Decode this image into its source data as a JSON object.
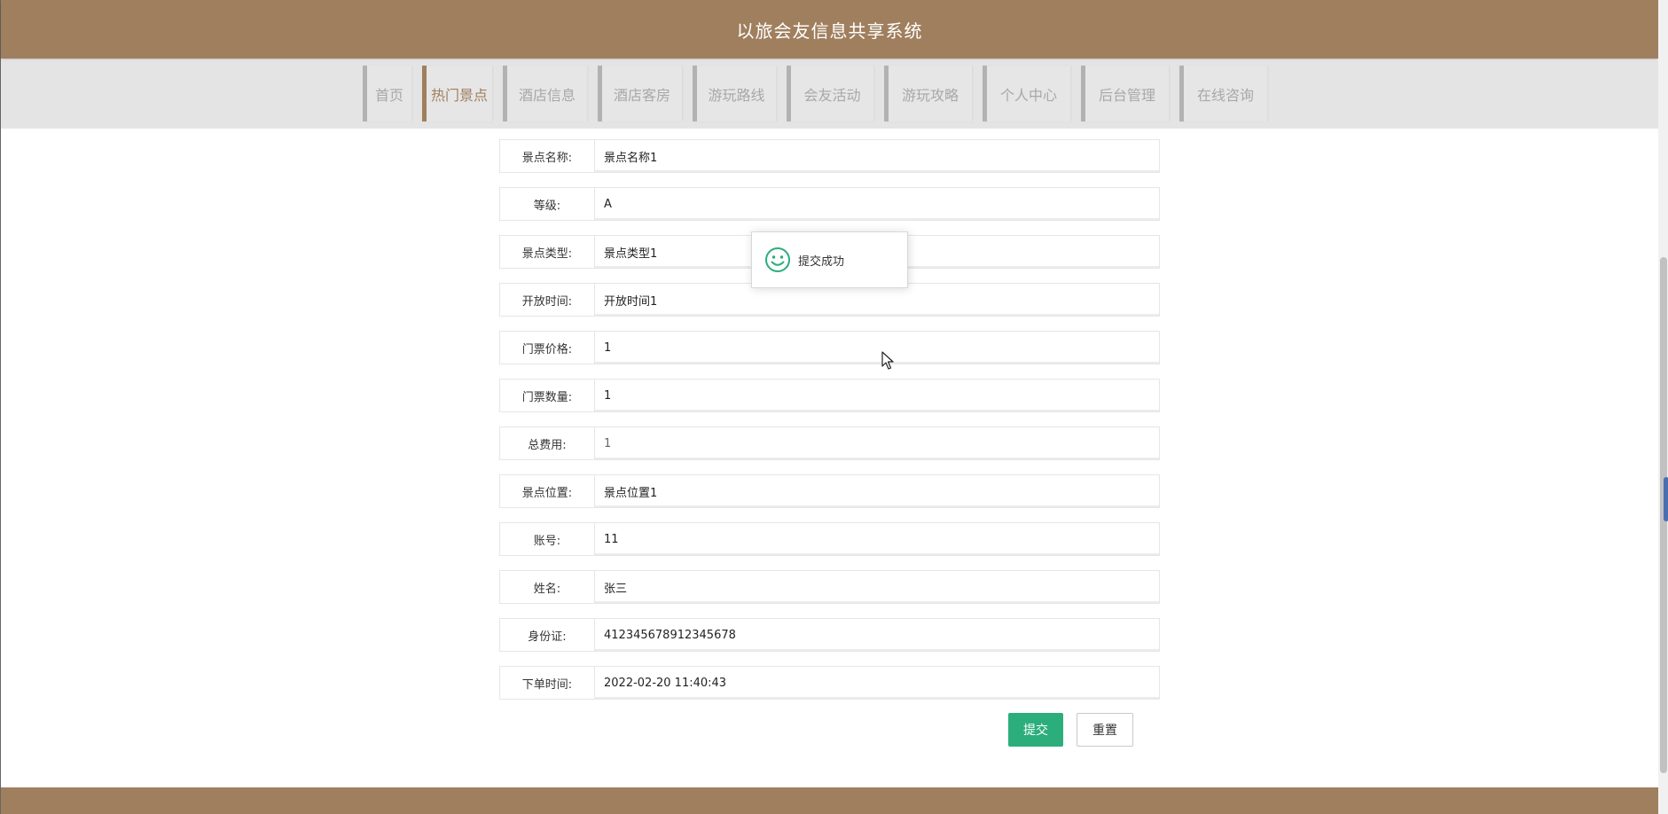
{
  "header": {
    "title": "以旅会友信息共享系统"
  },
  "nav": {
    "items": [
      {
        "label": "首页",
        "active": false
      },
      {
        "label": "热门景点",
        "active": true
      },
      {
        "label": "酒店信息",
        "active": false
      },
      {
        "label": "酒店客房",
        "active": false
      },
      {
        "label": "游玩路线",
        "active": false
      },
      {
        "label": "会友活动",
        "active": false
      },
      {
        "label": "游玩攻略",
        "active": false
      },
      {
        "label": "个人中心",
        "active": false
      },
      {
        "label": "后台管理",
        "active": false
      },
      {
        "label": "在线咨询",
        "active": false
      }
    ]
  },
  "form": {
    "fields": [
      {
        "label": "景点名称:",
        "value": "景点名称1"
      },
      {
        "label": "等级:",
        "value": "A"
      },
      {
        "label": "景点类型:",
        "value": "景点类型1"
      },
      {
        "label": "开放时间:",
        "value": "开放时间1"
      },
      {
        "label": "门票价格:",
        "value": "1"
      },
      {
        "label": "门票数量:",
        "value": "1"
      },
      {
        "label": "总费用:",
        "value": "1"
      },
      {
        "label": "景点位置:",
        "value": "景点位置1"
      },
      {
        "label": "账号:",
        "value": "11"
      },
      {
        "label": "姓名:",
        "value": "张三"
      },
      {
        "label": "身份证:",
        "value": "412345678912345678"
      },
      {
        "label": "下单时间:",
        "value": "2022-02-20 11:40:43"
      }
    ],
    "submit_label": "提交",
    "reset_label": "重置"
  },
  "toast": {
    "icon": "smile-icon",
    "text": "提交成功"
  },
  "colors": {
    "brand": "#a07f5e",
    "success": "#2bae7b",
    "nav_bg": "#e4e4e4"
  }
}
